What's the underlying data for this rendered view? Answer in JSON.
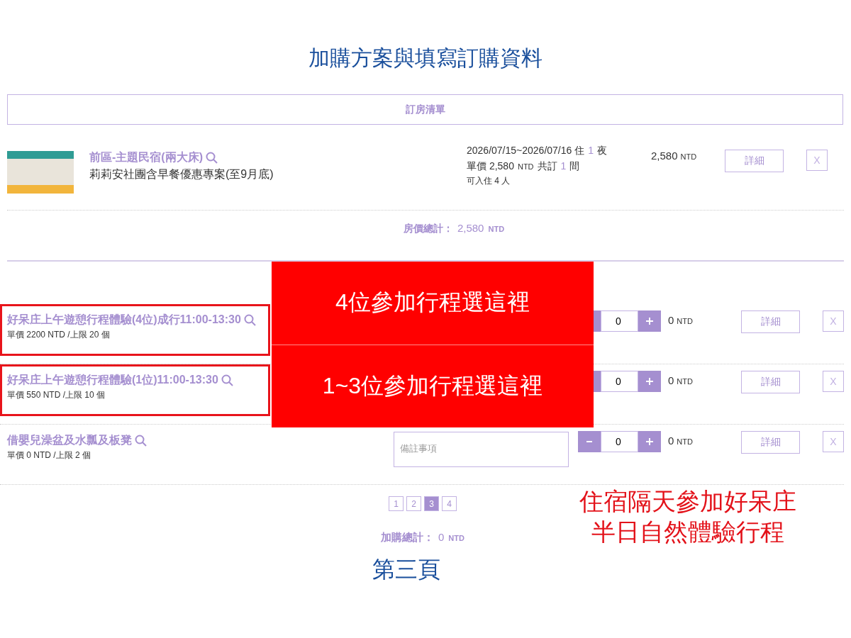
{
  "page_title": "加購方案與填寫訂購資料",
  "room_list": {
    "header": "訂房清單",
    "rooms": [
      {
        "name": "前區-主題民宿(兩大床)",
        "plan": "莉莉安社團含早餐優惠專案(至9月底)",
        "info_lines": [
          [
            {
              "text": "2026/07/15~2026/07/16 住",
              "accent": false
            },
            {
              "text": "1",
              "accent": true
            },
            {
              "text": "夜",
              "accent": false
            }
          ],
          [
            {
              "text": "單價 2,580",
              "accent": false
            },
            {
              "text": "NTD",
              "accent": false,
              "kind": "unit"
            },
            {
              "text": "共訂",
              "accent": false
            },
            {
              "text": "1",
              "accent": true
            },
            {
              "text": "間",
              "accent": false
            }
          ]
        ],
        "capacity": "可入住 4 人",
        "price": "2,580",
        "unit": "NTD",
        "detail_label": "詳細",
        "remove_label": "X"
      }
    ],
    "total_label": "房價總計：",
    "total": "2,580",
    "total_unit": "NTD"
  },
  "addons": {
    "items": [
      {
        "name": "好呆庄上午遊憩行程體驗(4位)成行11:00-13:30",
        "meta": "單價 2200 NTD /上限 20 個",
        "highlighted": true,
        "quantity": "0",
        "price": "0",
        "unit": "NTD",
        "detail_label": "詳細",
        "remove_label": "X"
      },
      {
        "name": "好呆庄上午遊憩行程體驗(1位)11:00-13:30",
        "meta": "單價 550 NTD /上限 10 個",
        "highlighted": true,
        "quantity": "0",
        "price": "0",
        "unit": "NTD",
        "detail_label": "詳細",
        "remove_label": "X"
      },
      {
        "name": "借嬰兒澡盆及水瓢及板凳",
        "meta": "單價 0 NTD /上限 2 個",
        "highlighted": false,
        "note_placeholder": "備註事項",
        "quantity": "0",
        "price": "0",
        "unit": "NTD",
        "detail_label": "詳細",
        "remove_label": "X"
      }
    ],
    "pages": [
      {
        "label": "1",
        "selected": false
      },
      {
        "label": "2",
        "selected": false
      },
      {
        "label": "3",
        "selected": true
      },
      {
        "label": "4",
        "selected": false
      }
    ],
    "total_label": "加購總計：",
    "total": "0",
    "total_unit": "NTD"
  },
  "annotations": {
    "callouts": [
      "4位參加行程選這裡",
      "1~3位參加行程選這裡"
    ],
    "note_lines": [
      "住宿隔天參加好呆庄",
      "半日自然體驗行程"
    ],
    "page_note": "第三頁"
  }
}
